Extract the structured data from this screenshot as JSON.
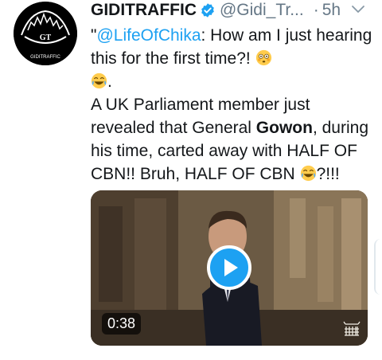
{
  "tweet": {
    "author_name": "GIDITRAFFIC",
    "author_handle": "@Gidi_Tr...",
    "separator": "·",
    "time": "5h",
    "avatar_text_top": "GT",
    "avatar_text_bottom": "GIDITRAFFIC",
    "text": {
      "quote_open": "\"",
      "mention": "@LifeOfChika",
      "line1_rest": ": How am I just hearing this for the first time?! ",
      "line1_end": ".",
      "line2_a": "A UK Parliament member just revealed that General ",
      "line2_bold": "Gowon",
      "line2_b": ", during his time, carted away with HALF OF CBN!! Bruh, HALF OF CBN ",
      "line2_end": "?!!!"
    },
    "media": {
      "type": "video",
      "duration": "0:38"
    }
  },
  "colors": {
    "accent": "#1da1f2",
    "text": "#14171a",
    "muted": "#657786"
  },
  "icons": [
    "verified-icon",
    "chevron-down-icon",
    "flushed-emoji-icon",
    "laughing-emoji-icon",
    "play-icon",
    "portcullis-icon"
  ]
}
